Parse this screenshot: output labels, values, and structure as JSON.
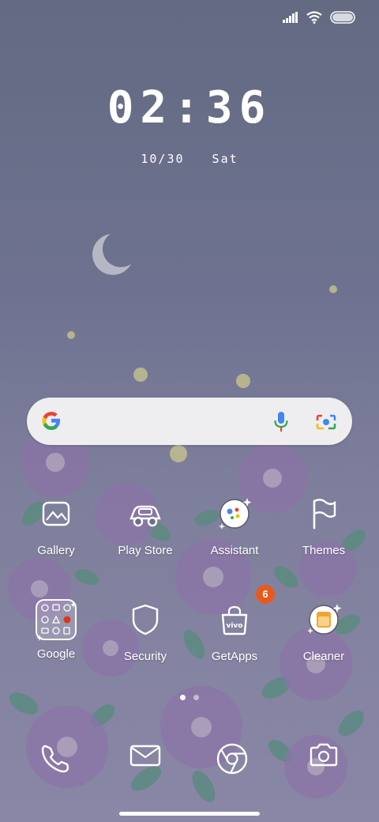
{
  "status_bar": {
    "signal": "signal-icon",
    "wifi": "wifi-icon",
    "battery": "battery-icon"
  },
  "clock": {
    "time": "02:36",
    "date": "10/30",
    "weekday": "Sat"
  },
  "search": {
    "logo": "google-g-icon",
    "mic": "mic-icon",
    "lens": "lens-icon"
  },
  "apps_row1": [
    {
      "label": "Gallery",
      "icon": "gallery-icon"
    },
    {
      "label": "Play Store",
      "icon": "play-store-icon"
    },
    {
      "label": "Assistant",
      "icon": "assistant-icon"
    },
    {
      "label": "Themes",
      "icon": "themes-icon"
    }
  ],
  "apps_row2": [
    {
      "label": "Google",
      "icon": "google-folder-icon"
    },
    {
      "label": "Security",
      "icon": "security-icon"
    },
    {
      "label": "GetApps",
      "icon": "getapps-icon",
      "badge": "6"
    },
    {
      "label": "Cleaner",
      "icon": "cleaner-icon"
    }
  ],
  "getapps_icon_text": "vivo",
  "page_indicator": {
    "pages": 2,
    "active": 1
  },
  "dock": [
    {
      "name": "phone",
      "icon": "phone-icon"
    },
    {
      "name": "messages",
      "icon": "mail-icon"
    },
    {
      "name": "browser",
      "icon": "chrome-icon"
    },
    {
      "name": "camera",
      "icon": "camera-icon"
    }
  ],
  "colors": {
    "badge": "#e85a1c",
    "wallpaper_top": "#646a82",
    "wallpaper_bottom": "#8a87a6",
    "flower": "#8c73a8",
    "leaf": "#5e8a82"
  }
}
